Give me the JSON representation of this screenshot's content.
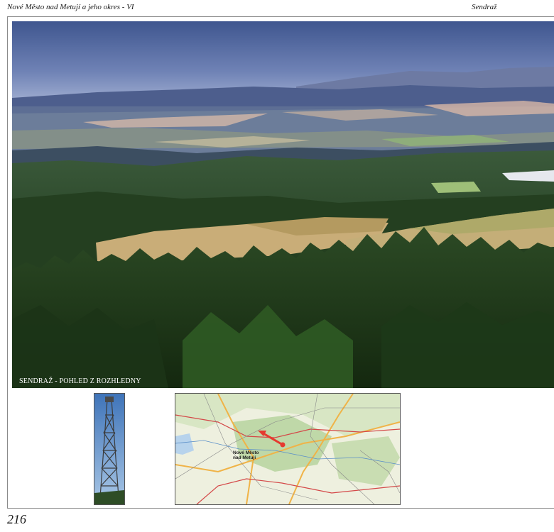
{
  "header": {
    "left_title": "Nové Město nad Metují a jeho okres - VI",
    "right_title": "Sendraž"
  },
  "photo": {
    "caption": "SENDRAŽ - POHLED Z ROZHLEDNY"
  },
  "map": {
    "town_label_line1": "Nové Město",
    "town_label_line2": "nad Metují"
  },
  "footer": {
    "page_number": "216"
  },
  "colors": {
    "sky_top": "#4a5f95",
    "sky_bottom": "#a8b4d2",
    "forest_dark": "#20391d",
    "field": "#c9ad78",
    "route_red": "#e53a2f"
  }
}
